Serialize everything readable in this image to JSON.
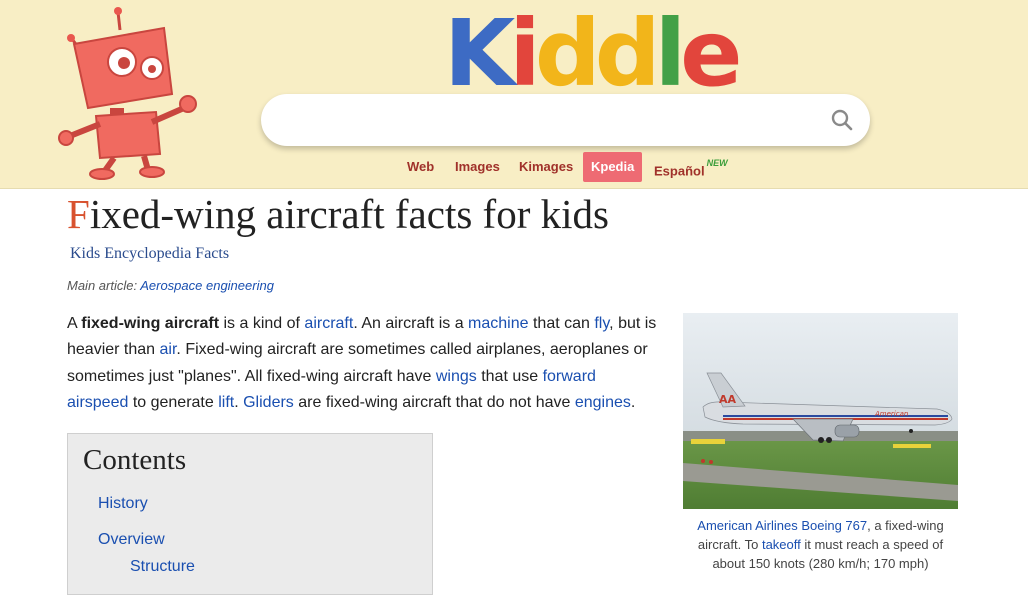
{
  "logo": {
    "letters": [
      "K",
      "i",
      "d",
      "d",
      "l",
      "e"
    ],
    "colors": [
      "#3d6bc4",
      "#e2453c",
      "#f2b51a",
      "#f2b51a",
      "#43a047",
      "#e2453c"
    ]
  },
  "search": {
    "value": "",
    "placeholder": ""
  },
  "tabs": [
    {
      "label": "Web",
      "active": false
    },
    {
      "label": "Images",
      "active": false
    },
    {
      "label": "Kimages",
      "active": false
    },
    {
      "label": "Kpedia",
      "active": true
    },
    {
      "label": "Español",
      "badge": "NEW",
      "active": false
    }
  ],
  "article": {
    "title_first": "F",
    "title_rest": "ixed-wing aircraft facts for kids",
    "subtitle": "Kids Encyclopedia Facts",
    "main_article_label": "Main article:",
    "main_article_link": "Aerospace engineering",
    "para": {
      "t1": "A ",
      "b1": "fixed-wing aircraft",
      "t2": " is a kind of ",
      "l_aircraft": "aircraft",
      "t3": ". An aircraft is a ",
      "l_machine": "machine",
      "t4": " that can ",
      "l_fly": "fly",
      "t5": ", but is heavier than ",
      "l_air": "air",
      "t6": ". Fixed-wing aircraft are sometimes called airplanes, aeroplanes or sometimes just \"planes\". All fixed-wing aircraft have ",
      "l_wings": "wings",
      "t7": " that use ",
      "l_forward_airspeed": "forward airspeed",
      "t8": " to generate ",
      "l_lift": "lift",
      "t9": ". ",
      "l_gliders": "Gliders",
      "t10": " are fixed-wing aircraft that do not have ",
      "l_engines": "engines",
      "t11": "."
    }
  },
  "toc": {
    "heading": "Contents",
    "items": [
      "History",
      "Overview",
      "Structure"
    ]
  },
  "figure": {
    "caption_link": "American Airlines Boeing 767",
    "caption_t1": ", a fixed-wing aircraft. To ",
    "caption_link2": "takeoff",
    "caption_t2": " it must reach a speed of about 150 knots (280 km/h; 170 mph)",
    "fuselage_text": "American",
    "tail_text": "AA"
  }
}
